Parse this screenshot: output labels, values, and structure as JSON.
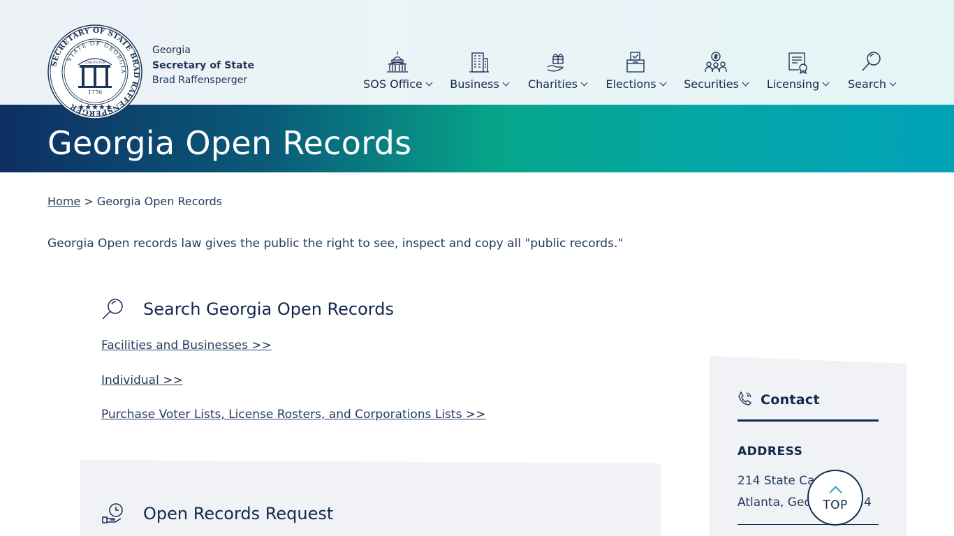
{
  "brand": {
    "line1": "Georgia",
    "line2": "Secretary of State",
    "line3": "Brad Raffensperger"
  },
  "seal": {
    "outer_text": "SECRETARY OF STATE BRAD RAFFENSPERGER",
    "inner_text": "STATE OF GEORGIA",
    "arch_text": "CONSTITUTION",
    "motto": "WISDOM JUSTICE MODERATION",
    "year": "1776"
  },
  "nav": {
    "items": [
      {
        "label": "SOS Office",
        "icon": "capitol-icon"
      },
      {
        "label": "Business",
        "icon": "building-icon"
      },
      {
        "label": "Charities",
        "icon": "gift-hand-icon"
      },
      {
        "label": "Elections",
        "icon": "ballot-box-icon"
      },
      {
        "label": "Securities",
        "icon": "people-money-icon"
      },
      {
        "label": "Licensing",
        "icon": "certificate-icon"
      },
      {
        "label": "Search",
        "icon": "search-icon"
      }
    ]
  },
  "banner": {
    "title": "Georgia Open Records"
  },
  "breadcrumb": {
    "home": "Home",
    "separator": " > ",
    "current": "Georgia Open Records"
  },
  "intro": "Georgia Open records law gives the public the right to see, inspect and copy all \"public records.\"",
  "search_section": {
    "title": "Search Georgia Open Records",
    "links": [
      "Facilities and Businesses >>",
      "Individual >>",
      "Purchase Voter Lists, License Rosters, and Corporations Lists >>"
    ]
  },
  "request_section": {
    "title": "Open Records Request"
  },
  "contact": {
    "title": "Contact",
    "address_label": "ADDRESS",
    "address_line1": "214 State Ca",
    "address_line2": "Atlanta, Geo",
    "address_line2_tail": "4"
  },
  "top_button": {
    "label": "TOP"
  },
  "colors": {
    "navy": "#11294d",
    "teal_accent": "#2aa9b8",
    "banner_start": "#0e2f63",
    "banner_mid": "#06a58a",
    "banner_end": "#00a2b8"
  }
}
